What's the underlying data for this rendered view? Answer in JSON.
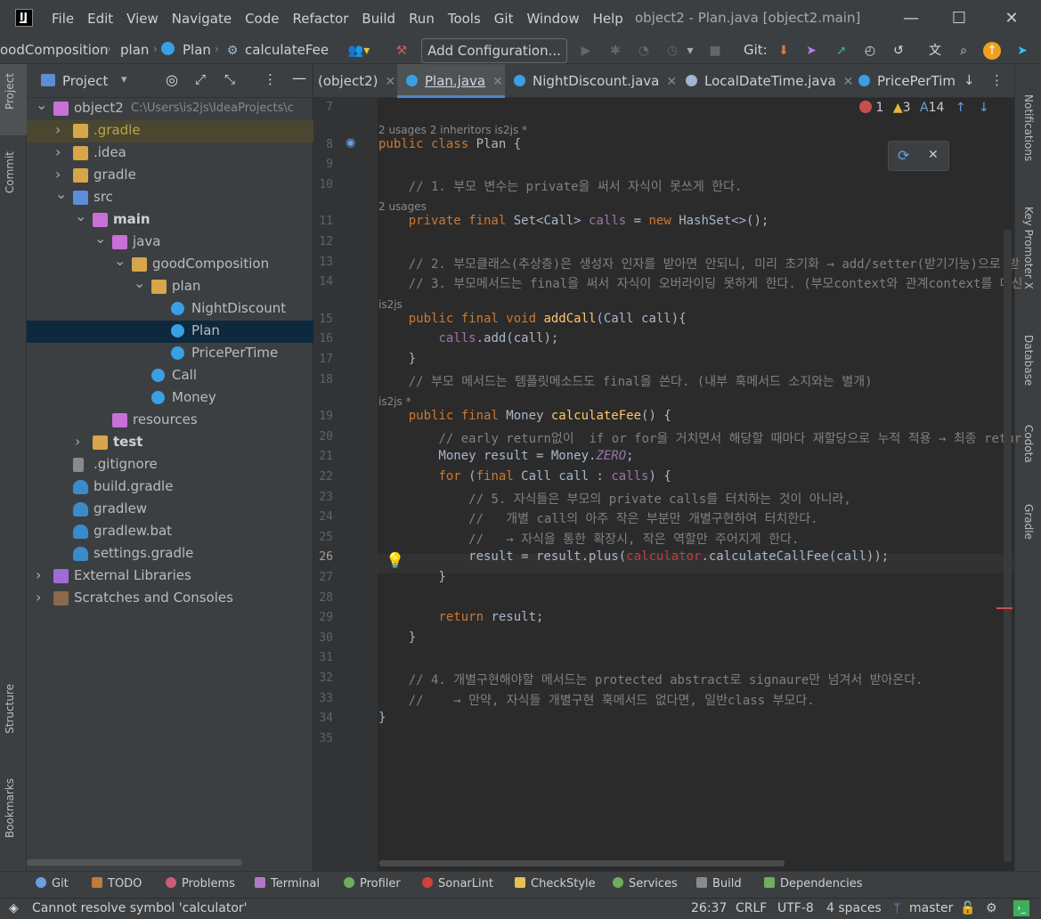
{
  "titlebar": {
    "logo_text": "IJ",
    "menus": [
      "File",
      "Edit",
      "View",
      "Navigate",
      "Code",
      "Refactor",
      "Build",
      "Run",
      "Tools",
      "Git",
      "Window",
      "Help"
    ],
    "window_title": "object2 - Plan.java [object2.main]",
    "minimize": "—",
    "maximize": "☐",
    "close": "✕"
  },
  "toolbar": {
    "breadcrumb": [
      "oodComposition",
      "plan",
      "Plan",
      "calculateFee"
    ],
    "add_configuration": "Add Configuration...",
    "git_label": "Git:"
  },
  "left_tabs": [
    "Project",
    "Commit",
    "Structure",
    "Bookmarks"
  ],
  "right_tabs": [
    "Notifications",
    "Key Promoter X",
    "Database",
    "Codota",
    "Gradle"
  ],
  "project_panel": {
    "title": "Project",
    "tree": [
      {
        "label": "object2",
        "path": "C:\\Users\\is2js\\IdeaProjects\\c",
        "icon": "module",
        "expanded": true,
        "depth": 0
      },
      {
        "label": ".gradle",
        "icon": "folder",
        "expanded": false,
        "depth": 1,
        "color": "#b8a44a",
        "highlight": true
      },
      {
        "label": ".idea",
        "icon": "folder",
        "expanded": false,
        "depth": 1
      },
      {
        "label": "gradle",
        "icon": "folder",
        "expanded": false,
        "depth": 1
      },
      {
        "label": "src",
        "icon": "src",
        "expanded": true,
        "depth": 1
      },
      {
        "label": "main",
        "icon": "module",
        "expanded": true,
        "depth": 2,
        "bold": true
      },
      {
        "label": "java",
        "icon": "module",
        "expanded": true,
        "depth": 3
      },
      {
        "label": "goodComposition",
        "icon": "folder",
        "expanded": true,
        "depth": 4
      },
      {
        "label": "plan",
        "icon": "folder",
        "expanded": true,
        "depth": 5
      },
      {
        "label": "NightDiscount",
        "icon": "class",
        "depth": 6
      },
      {
        "label": "Plan",
        "icon": "class",
        "depth": 6,
        "selected": true
      },
      {
        "label": "PricePerTime",
        "icon": "class",
        "depth": 6
      },
      {
        "label": "Call",
        "icon": "class",
        "depth": 5
      },
      {
        "label": "Money",
        "icon": "class",
        "depth": 5
      },
      {
        "label": "resources",
        "icon": "module",
        "depth": 3
      },
      {
        "label": "test",
        "icon": "folder",
        "expanded": false,
        "depth": 2,
        "bold": true
      },
      {
        "label": ".gitignore",
        "icon": "file",
        "depth": 1
      },
      {
        "label": "build.gradle",
        "icon": "gradle",
        "depth": 1
      },
      {
        "label": "gradlew",
        "icon": "gradle",
        "depth": 1
      },
      {
        "label": "gradlew.bat",
        "icon": "gradle",
        "depth": 1
      },
      {
        "label": "settings.gradle",
        "icon": "gradle",
        "depth": 1
      },
      {
        "label": "External Libraries",
        "icon": "lib",
        "expanded": false,
        "depth": 0
      },
      {
        "label": "Scratches and Consoles",
        "icon": "scratch",
        "expanded": false,
        "depth": 0
      }
    ]
  },
  "editor_tabs": [
    {
      "label": "(object2)",
      "active": false
    },
    {
      "label": "Plan.java",
      "active": true
    },
    {
      "label": "NightDiscount.java",
      "active": false
    },
    {
      "label": "LocalDateTime.java",
      "active": false
    },
    {
      "label": "PricePerTim",
      "active": false
    }
  ],
  "inspections": {
    "errors": "1",
    "warnings": "3",
    "typos": "14"
  },
  "code_lines": [
    {
      "n": "7",
      "html": ""
    },
    {
      "hint": "2 usages   2 inheritors   is2js *"
    },
    {
      "n": "8",
      "html": "<span class=\"kw\">public class </span>Plan {"
    },
    {
      "n": "9",
      "html": ""
    },
    {
      "n": "10",
      "html": "    <span class=\"cm\">// 1. 부모 변수는 private을 써서 자식이 못쓰게 한다.</span>"
    },
    {
      "hint": "    2 usages"
    },
    {
      "n": "11",
      "html": "    <span class=\"kw\">private final </span>Set&lt;Call&gt; <span class=\"fld\">calls</span> = <span class=\"kw\">new </span>HashSet&lt;&gt;();"
    },
    {
      "n": "12",
      "html": ""
    },
    {
      "n": "13",
      "html": "    <span class=\"cm\">// 2. 부모클래스(추상층)은 생성자 인자를 받아면 안되니, 미리 초기화 → add/setter(받기기능)으로 받</span>"
    },
    {
      "n": "14",
      "html": "    <span class=\"cm\">// 3. 부모메서드는 final을 써서 자식이 오버라이딩 못하게 한다. (부모context와 관계context를 대신</span>"
    },
    {
      "hint": "    is2js"
    },
    {
      "n": "15",
      "html": "    <span class=\"kw\">public final void </span><span class=\"fn\">addCall</span>(Call call){"
    },
    {
      "n": "16",
      "html": "        <span class=\"fld\">calls</span>.add(call);"
    },
    {
      "n": "17",
      "html": "    }"
    },
    {
      "n": "18",
      "html": "    <span class=\"cm\">// 부모 메서드는 템플릿메소드도 final을 쓴다. (내부 훅메서드 소지와는 별개)</span>"
    },
    {
      "hint": "    is2js *"
    },
    {
      "n": "19",
      "html": "    <span class=\"kw\">public final </span>Money <span class=\"fn\">calculateFee</span>() {"
    },
    {
      "n": "20",
      "html": "        <span class=\"cm\">// early return없이  if or for을 거치면서 해당할 때마다 재할당으로 누적 적용 → 최종 retur</span>"
    },
    {
      "n": "21",
      "html": "        Money result = Money.<span class=\"it\">ZERO</span>;"
    },
    {
      "n": "22",
      "html": "        <span class=\"kw\">for </span>(<span class=\"kw\">final </span>Call call : <span class=\"fld\">calls</span>) {"
    },
    {
      "n": "23",
      "html": "            <span class=\"cm\">// 5. 자식들은 부모의 private calls를 터치하는 것이 아니라,</span>"
    },
    {
      "n": "24",
      "html": "            <span class=\"cm\">//   개별 call의 아주 작은 부분만 개별구현하여 터치한다.</span>"
    },
    {
      "n": "25",
      "html": "            <span class=\"cm\">//   → 자식을 통한 확장시, 작은 역할만 주어지게 한다.</span>"
    },
    {
      "n": "26",
      "html": "            result = result.plus(<span class=\"err\">calculator</span>.calculateCallFee(call));"
    },
    {
      "n": "27",
      "html": "        }"
    },
    {
      "n": "28",
      "html": ""
    },
    {
      "n": "29",
      "html": "        <span class=\"kw\">return </span>result;"
    },
    {
      "n": "30",
      "html": "    }"
    },
    {
      "n": "31",
      "html": ""
    },
    {
      "n": "32",
      "html": "    <span class=\"cm\">// 4. 개별구현해야할 메서드는 protected abstract로 signaure만 넘겨서 받아온다.</span>"
    },
    {
      "n": "33",
      "html": "    <span class=\"cm\">//    → 만약, 자식들 개별구현 훅메서드 없다면, 일반class 부모다.</span>"
    },
    {
      "n": "34",
      "html": "}"
    },
    {
      "n": "35",
      "html": ""
    }
  ],
  "bottom_tabs": [
    "Git",
    "TODO",
    "Problems",
    "Terminal",
    "Profiler",
    "SonarLint",
    "CheckStyle",
    "Services",
    "Build",
    "Dependencies"
  ],
  "status": {
    "message": "Cannot resolve symbol 'calculator'",
    "position": "26:37",
    "line_sep": "CRLF",
    "encoding": "UTF-8",
    "indent": "4 spaces",
    "branch": "master"
  }
}
